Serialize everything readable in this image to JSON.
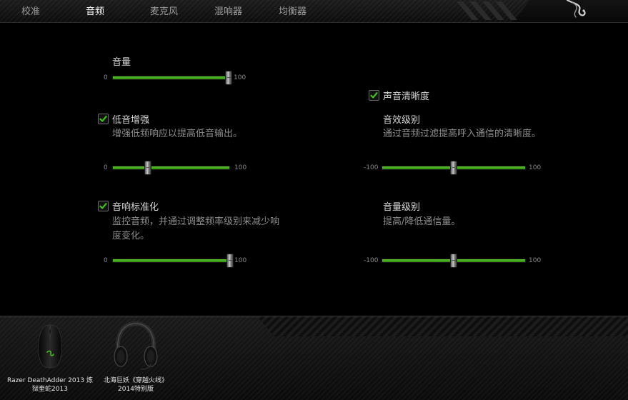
{
  "tabs": [
    {
      "label": "校准",
      "active": false
    },
    {
      "label": "音频",
      "active": true
    },
    {
      "label": "麦克风",
      "active": false
    },
    {
      "label": "混响器",
      "active": false
    },
    {
      "label": "均衡器",
      "active": false
    }
  ],
  "volume": {
    "title": "音量",
    "min_label": "0",
    "max_label": "100",
    "value": 100
  },
  "bass_boost": {
    "title": "低音增强",
    "checked": true,
    "description": "增强低频响应以提高低音输出。",
    "min_label": "0",
    "max_label": "100",
    "value": 30
  },
  "sound_normalization": {
    "title": "音响标准化",
    "checked": true,
    "description": "监控音频，并通过调整频率级别来减少响度变化。",
    "min_label": "0",
    "max_label": "100",
    "value": 100
  },
  "voice_clarity": {
    "title": "声音清晰度",
    "checked": true
  },
  "effect_level": {
    "title": "音效级别",
    "description": "通过音频过滤提高呼入通信的清晰度。",
    "min_label": "-100",
    "max_label": "100",
    "value": 0
  },
  "volume_level": {
    "title": "音量级别",
    "description": "提高/降低通信量。",
    "min_label": "-100",
    "max_label": "100",
    "value": 0
  },
  "devices": [
    {
      "name_line1": "Razer DeathAdder 2013 炼",
      "name_line2": "狱奎蛇2013",
      "icon": "mouse-icon"
    },
    {
      "name_line1": "北海巨妖《穿越火线》",
      "name_line2": "2014特别版",
      "icon": "headset-icon"
    }
  ],
  "colors": {
    "accent_green": "#44c01c",
    "background": "#000000"
  }
}
